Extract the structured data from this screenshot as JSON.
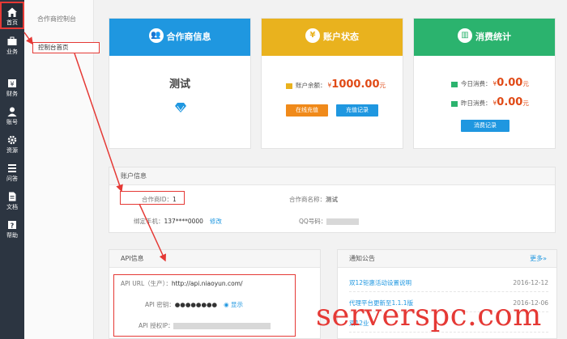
{
  "nav": {
    "items": [
      {
        "label": "首页",
        "icon": "home-icon"
      },
      {
        "label": "业务",
        "icon": "briefcase-icon"
      },
      {
        "label": "财务",
        "icon": "finance-icon"
      },
      {
        "label": "账号",
        "icon": "user-icon"
      },
      {
        "label": "资源",
        "icon": "gear-icon"
      },
      {
        "label": "问答",
        "icon": "list-icon"
      },
      {
        "label": "文档",
        "icon": "document-icon"
      },
      {
        "label": "帮助",
        "icon": "help-icon"
      }
    ]
  },
  "submenu": {
    "title": "合作商控制台",
    "item": "控制台首页"
  },
  "cards": {
    "partner": {
      "title": "合作商信息",
      "name": "测试",
      "icon": "users-icon"
    },
    "account": {
      "title": "账户状态",
      "icon": "yen-icon",
      "balance_label": "账户余额：",
      "currency": "¥",
      "balance": "1000.00",
      "unit": "元",
      "recharge_button": "在线充值",
      "records_button": "充值记录"
    },
    "consumption": {
      "title": "消费统计",
      "icon": "bar-chart-icon",
      "today_label": "今日消费：",
      "today_currency": "¥",
      "today_value": "0.00",
      "today_unit": "元",
      "yesterday_label": "昨日消费：",
      "yesterday_currency": "¥",
      "yesterday_value": "0.00",
      "yesterday_unit": "元",
      "records_button": "消费记录"
    }
  },
  "account_info": {
    "title": "账户信息",
    "partner_id_label": "合作商ID：",
    "partner_id": "1",
    "partner_name_label": "合作商名称：",
    "partner_name": "测试",
    "phone_label": "绑定手机：",
    "phone": "137****0000",
    "edit_link": "修改",
    "qq_label": "QQ号码："
  },
  "api_info": {
    "title": "API信息",
    "url_label": "API URL（生产）：",
    "url": "http://api.niaoyun.com/",
    "key_label": "API 密钥：",
    "key_masked": "●●●●●●●●",
    "show_link": "显示",
    "ip_label": "API 授权IP："
  },
  "notices": {
    "title": "通知公告",
    "more": "更多»",
    "items": [
      {
        "title": "双12钜惠活动设置说明",
        "date": "2016-12-12"
      },
      {
        "title": "代理平台更新至1.1.1版",
        "date": "2016-12-06"
      },
      {
        "title": "双12业",
        "date": ""
      }
    ]
  },
  "watermark": "serverspc.com",
  "colors": {
    "blue": "#1f97e0",
    "yellow": "#e9b21e",
    "green": "#2bb36e",
    "sidebar": "#2c3541",
    "annotation_red": "#e53935",
    "price": "#e04a16"
  }
}
